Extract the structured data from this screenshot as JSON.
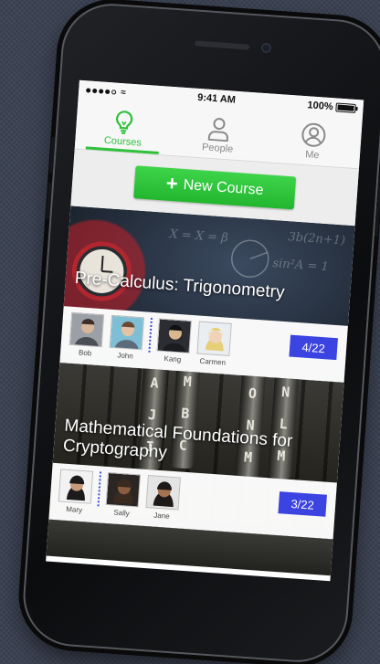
{
  "status_bar": {
    "time": "9:41 AM",
    "battery": "100%"
  },
  "tabs": [
    {
      "label": "Courses",
      "icon": "lightbulb-icon",
      "active": true
    },
    {
      "label": "People",
      "icon": "person-icon",
      "active": false
    },
    {
      "label": "Me",
      "icon": "profile-icon",
      "active": false
    }
  ],
  "new_course_label": "New Course",
  "courses": [
    {
      "title": "Pre-Calculus: Trigonometry",
      "members": [
        {
          "name": "Bob"
        },
        {
          "name": "John"
        },
        {
          "name": "Kang"
        },
        {
          "name": "Carmen"
        }
      ],
      "progress": "4/22"
    },
    {
      "title": "Mathematical Foundations for Cryptography",
      "members": [
        {
          "name": "Mary"
        },
        {
          "name": "Sally"
        },
        {
          "name": "Jane"
        }
      ],
      "progress": "3/22"
    }
  ],
  "colors": {
    "accent": "#2ec13a",
    "badge": "#3b43e0"
  }
}
